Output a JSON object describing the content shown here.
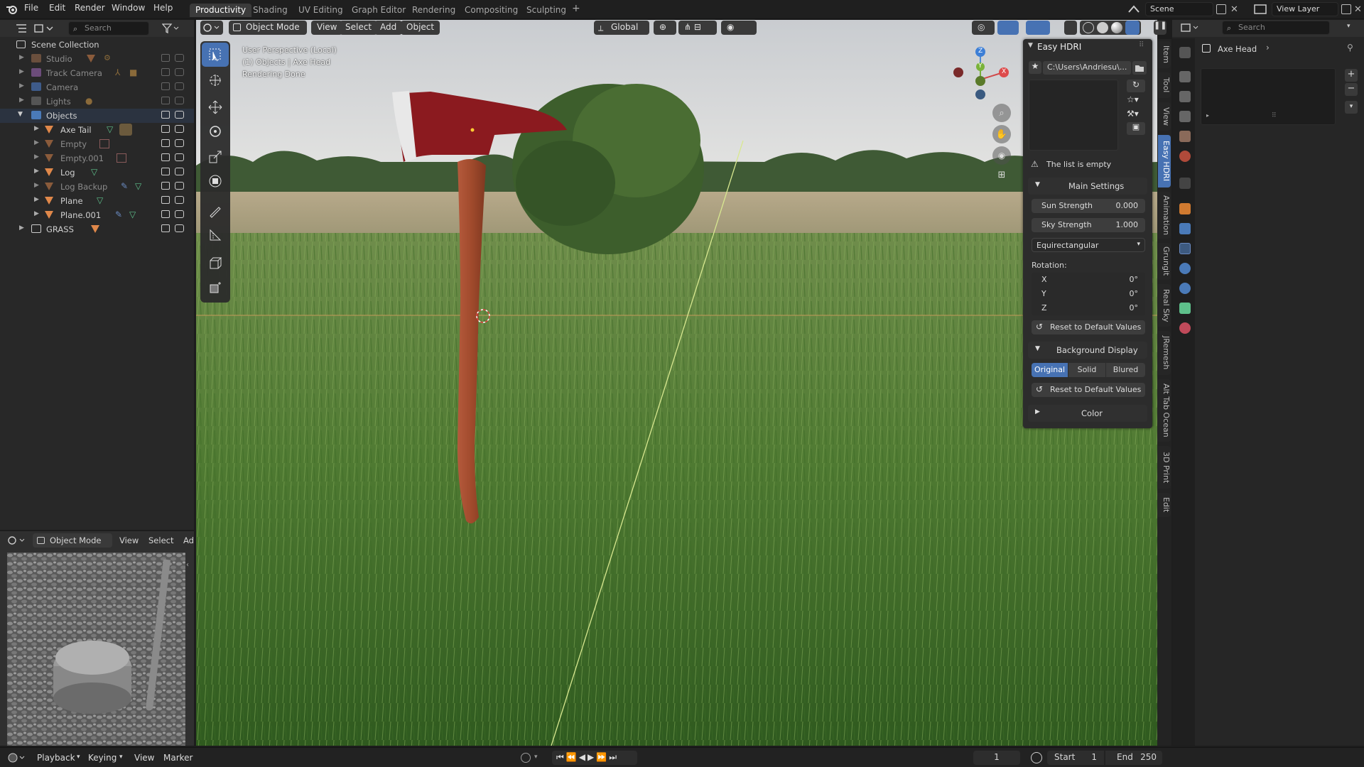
{
  "app": {
    "logo_icon": "blender-logo-icon"
  },
  "menu": [
    "File",
    "Edit",
    "Render",
    "Window",
    "Help"
  ],
  "workspaces": [
    {
      "label": "Productivity",
      "active": true
    },
    {
      "label": "Shading"
    },
    {
      "label": "UV Editing"
    },
    {
      "label": "Graph Editor"
    },
    {
      "label": "Rendering"
    },
    {
      "label": "Compositing"
    },
    {
      "label": "Sculpting"
    }
  ],
  "top_right": {
    "scene": "Scene",
    "view_layer": "View Layer"
  },
  "outliner": {
    "search_placeholder": "Search",
    "root": "Scene Collection",
    "rows": [
      {
        "label": "Studio",
        "dim": true
      },
      {
        "label": "Track Camera",
        "dim": true
      },
      {
        "label": "Camera",
        "dim": true
      },
      {
        "label": "Lights",
        "dim": true
      },
      {
        "label": "Objects",
        "dim": false
      },
      {
        "label": "Axe Tail",
        "dim": false
      },
      {
        "label": "Empty",
        "dim": true
      },
      {
        "label": "Empty.001",
        "dim": true
      },
      {
        "label": "Log",
        "dim": false
      },
      {
        "label": "Log Backup",
        "dim": true
      },
      {
        "label": "Plane",
        "dim": false
      },
      {
        "label": "Plane.001",
        "dim": false
      },
      {
        "label": "GRASS",
        "dim": false
      }
    ]
  },
  "mini_view": {
    "mode": "Object Mode",
    "menus": [
      "View",
      "Select",
      "Ad"
    ]
  },
  "viewport": {
    "mode": "Object Mode",
    "menus": [
      "View",
      "Select",
      "Add",
      "Object"
    ],
    "orientation": "Global",
    "overlay_text": [
      "User Perspective (Local)",
      "(1) Objects | Axe Head",
      "Rendering Done"
    ],
    "gizmo_axes": {
      "z": "Z",
      "y": "Y",
      "x": "X"
    }
  },
  "easy_hdri": {
    "title": "Easy HDRI",
    "path": "C:\\Users\\Andriesu\\...",
    "empty_msg": "The list is empty",
    "main_settings": "Main Settings",
    "sun_strength_label": "Sun Strength",
    "sun_strength": "0.000",
    "sky_strength_label": "Sky Strength",
    "sky_strength": "1.000",
    "projection": "Equirectangular",
    "rotation_label": "Rotation:",
    "rot_x_label": "X",
    "rot_x": "0°",
    "rot_y_label": "Y",
    "rot_y": "0°",
    "rot_z_label": "Z",
    "rot_z": "0°",
    "reset1": "Reset to Default Values",
    "bg_display": "Background Display",
    "bg_options": [
      "Original",
      "Solid",
      "Blured"
    ],
    "reset2": "Reset to Default Values",
    "color": "Color"
  },
  "side_tabs": [
    "Item",
    "Tool",
    "View",
    "Easy HDRI",
    "Animation",
    "Grungit",
    "Real Sky",
    "JRemesh",
    "Alt Tab Ocean",
    "3D Print",
    "Edit"
  ],
  "properties": {
    "search_placeholder": "Search",
    "object_name": "Axe Head"
  },
  "timeline": {
    "menus": [
      "Playback",
      "Keying",
      "View",
      "Marker"
    ],
    "current_frame": "1",
    "start_label": "Start",
    "start": "1",
    "end_label": "End",
    "end": "250"
  },
  "colors": {
    "accent": "#4772b3",
    "axe_head": "#8b1a1f",
    "handle": "#a14a2e",
    "object_orange": "#e0884a"
  }
}
